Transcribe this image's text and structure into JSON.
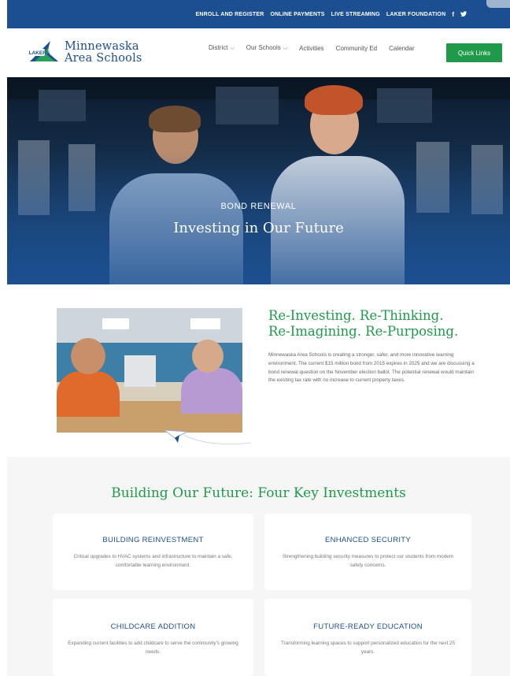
{
  "utility_bar": {
    "links": [
      "ENROLL AND REGISTER",
      "ONLINE PAYMENTS",
      "LIVE STREAMING",
      "LAKER FOUNDATION"
    ],
    "social": [
      "f",
      "✦"
    ]
  },
  "header": {
    "logo_badge": "LAKERS",
    "logo_line1": "Minnewaska",
    "logo_line2": "Area Schools",
    "nav": [
      {
        "label": "District",
        "dropdown": "⌵"
      },
      {
        "label": "Our Schools",
        "dropdown": "⌵"
      },
      {
        "label": "Activities"
      },
      {
        "label": "Community Ed"
      },
      {
        "label": "Calendar"
      }
    ],
    "quick_links": "Quick Links"
  },
  "hero": {
    "kicker": "BOND RENEWAL",
    "title": "Investing in Our Future"
  },
  "intro": {
    "heading_line1": "Re-Investing. Re-Thinking.",
    "heading_line2": "Re-Imagining. Re-Purposing.",
    "body": "Minnewaska Area Schools is creating a stronger, safer, and more innovative learning environment. The current $15 million bond from 2015 expires in 2025 and we are discussing a bond renewal question on the November election ballot. The potential renewal would maintain the existing tax rate with no increase to current property taxes."
  },
  "investments": {
    "title": "Building Our Future: Four Key Investments",
    "cards": [
      {
        "title": "BUILDING REINVESTMENT",
        "text": "Critical upgrades to HVAC systems and infrastructure to maintain a safe, comfortable learning environment."
      },
      {
        "title": "ENHANCED SECURITY",
        "text": "Strengthening building security measures to protect our students from modern safety concerns."
      },
      {
        "title": "CHILDCARE ADDITION",
        "text": "Expanding current facilities to add childcare to serve the community's growing needs."
      },
      {
        "title": "FUTURE-READY EDUCATION",
        "text": "Transforming learning spaces to support personalized education for the next 25 years."
      }
    ]
  },
  "colors": {
    "brand_blue": "#1b4f91",
    "brand_green": "#1f9a4a",
    "section_gray": "#f6f6f6"
  }
}
